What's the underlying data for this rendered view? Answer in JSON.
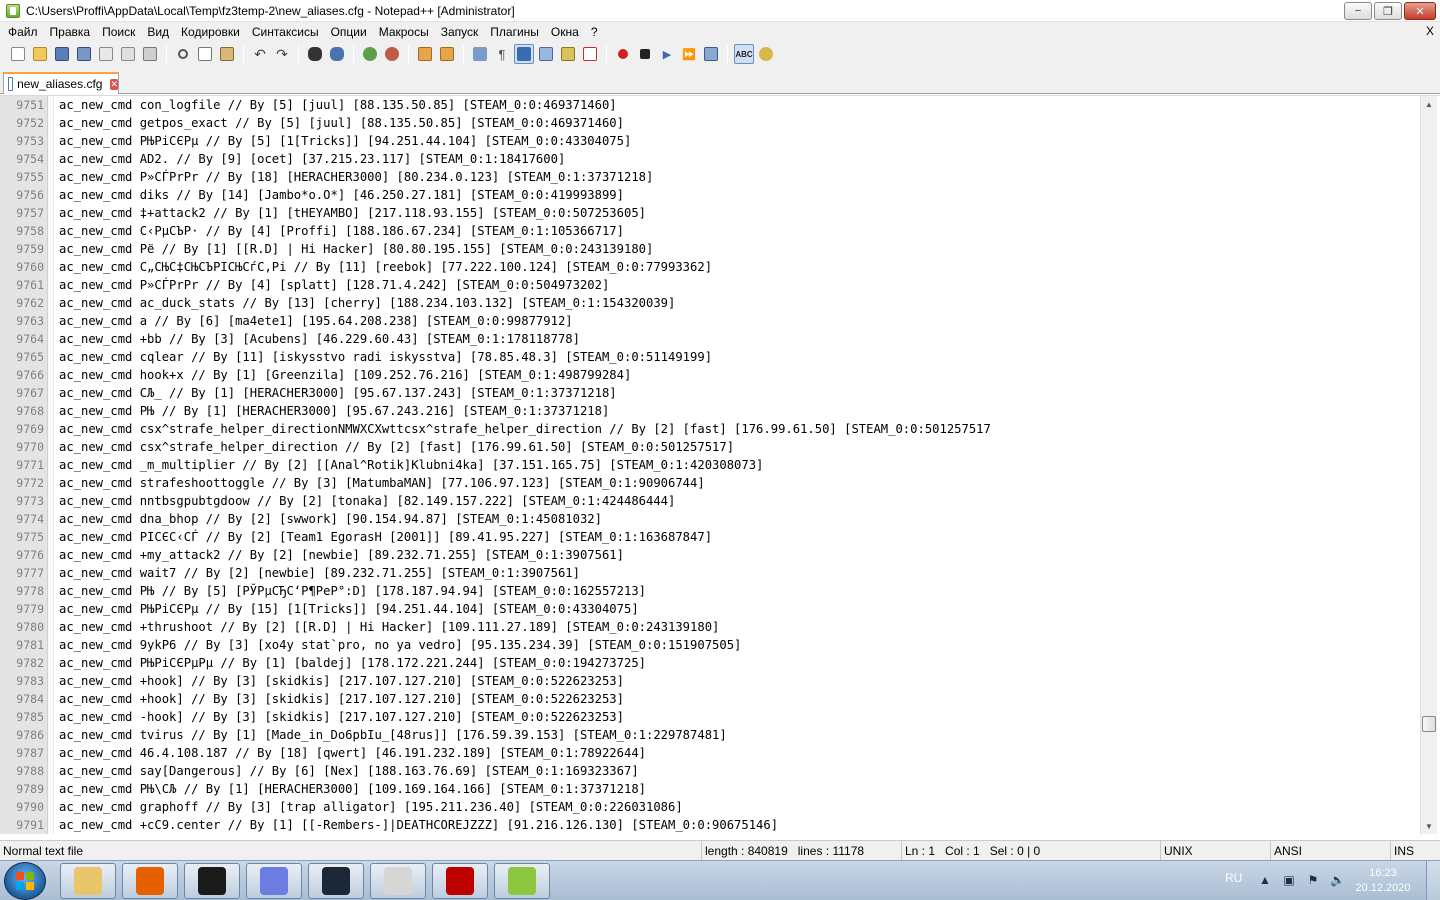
{
  "window": {
    "title": "C:\\Users\\Proffi\\AppData\\Local\\Temp\\fz3temp-2\\new_aliases.cfg - Notepad++ [Administrator]",
    "minimize": "−",
    "maximize": "❐",
    "close": "✕"
  },
  "menu": {
    "items": [
      "Файл",
      "Правка",
      "Поиск",
      "Вид",
      "Кодировки",
      "Синтаксисы",
      "Опции",
      "Макросы",
      "Запуск",
      "Плагины",
      "Окна",
      "?"
    ],
    "close_label": "X"
  },
  "tab": {
    "label": "new_aliases.cfg",
    "close": "✕"
  },
  "editor": {
    "lines": [
      {
        "n": "9751",
        "t": "ac_new_cmd con_logfile // By [5] [juul] [88.135.50.85] [STEAM_0:0:469371460]"
      },
      {
        "n": "9752",
        "t": "ac_new_cmd getpos_exact // By [5] [juul] [88.135.50.85] [STEAM_0:0:469371460]"
      },
      {
        "n": "9753",
        "t": "ac_new_cmd PЊPiCЄPµ // By [5] [1[Tricks]] [94.251.44.104] [STEAM_0:0:43304075]"
      },
      {
        "n": "9754",
        "t": "ac_new_cmd AD2. // By [9] [ocet] [37.215.23.117] [STEAM_0:1:18417600]"
      },
      {
        "n": "9755",
        "t": "ac_new_cmd P»CЃPrPr // By [18] [HERACHER3000] [80.234.0.123] [STEAM_0:1:37371218]"
      },
      {
        "n": "9756",
        "t": "ac_new_cmd diks // By [14] [Jambo*o.O*] [46.250.27.181] [STEAM_0:0:419993899]"
      },
      {
        "n": "9757",
        "t": "ac_new_cmd ‡+attack2 // By [1] [tHEYAMBO] [217.118.93.155] [STEAM_0:0:507253605]"
      },
      {
        "n": "9758",
        "t": "ac_new_cmd C‹PµCЪP· // By [4] [Proffi] [188.186.67.234] [STEAM_0:1:105366717]"
      },
      {
        "n": "9759",
        "t": "ac_new_cmd Pё // By [1] [[R.D] | Hi Hacker] [80.80.195.155] [STEAM_0:0:243139180]"
      },
      {
        "n": "9760",
        "t": "ac_new_cmd C„CЊC‡CЊCЪPICЊCѓC‚Pi // By [11] [reebok] [77.222.100.124] [STEAM_0:0:77993362]"
      },
      {
        "n": "9761",
        "t": "ac_new_cmd P»CЃPrPr // By [4] [splatt] [128.71.4.242] [STEAM_0:0:504973202]"
      },
      {
        "n": "9762",
        "t": "ac_new_cmd ac_duck_stats // By [13] [cherry] [188.234.103.132] [STEAM_0:1:154320039]"
      },
      {
        "n": "9763",
        "t": "ac_new_cmd a // By [6] [ma4ete1] [195.64.208.238] [STEAM_0:0:99877912]"
      },
      {
        "n": "9764",
        "t": "ac_new_cmd +bb // By [3] [Acubens] [46.229.60.43] [STEAM_0:1:178118778]"
      },
      {
        "n": "9765",
        "t": "ac_new_cmd cqlear // By [11] [iskysstvo radi iskysstva] [78.85.48.3] [STEAM_0:0:51149199]"
      },
      {
        "n": "9766",
        "t": "ac_new_cmd hook+x // By [1] [Greenzila] [109.252.76.216] [STEAM_0:1:498799284]"
      },
      {
        "n": "9767",
        "t": "ac_new_cmd CЉ_ // By [1] [HERACHER3000] [95.67.137.243] [STEAM_0:1:37371218]"
      },
      {
        "n": "9768",
        "t": "ac_new_cmd PЊ // By [1] [HERACHER3000] [95.67.243.216] [STEAM_0:1:37371218]"
      },
      {
        "n": "9769",
        "t": "ac_new_cmd csx^strafe_helper_directionNMWXCXwttcsx^strafe_helper_direction // By [2] [fast] [176.99.61.50] [STEAM_0:0:501257517"
      },
      {
        "n": "9770",
        "t": "ac_new_cmd csx^strafe_helper_direction // By [2] [fast] [176.99.61.50] [STEAM_0:0:501257517]"
      },
      {
        "n": "9771",
        "t": "ac_new_cmd _m_multiplier // By [2] [[Anal^Rotik]Klubni4ka] [37.151.165.75] [STEAM_0:1:420308073]"
      },
      {
        "n": "9772",
        "t": "ac_new_cmd strafeshoottoggle // By [3] [MatumbaMAN] [77.106.97.123] [STEAM_0:1:90906744]"
      },
      {
        "n": "9773",
        "t": "ac_new_cmd nntbsgpubtgdoow // By [2] [tonaka] [82.149.157.222] [STEAM_0:1:424486444]"
      },
      {
        "n": "9774",
        "t": "ac_new_cmd dna_bhop // By [2] [swwork] [90.154.94.87] [STEAM_0:1:45081032]"
      },
      {
        "n": "9775",
        "t": "ac_new_cmd PICЄC‹CЃ // By [2] [Team1 EgorasH [2001]] [89.41.95.227] [STEAM_0:1:163687847]"
      },
      {
        "n": "9776",
        "t": "ac_new_cmd +my_attack2 // By [2] [newbie] [89.232.71.255] [STEAM_0:1:3907561]"
      },
      {
        "n": "9777",
        "t": "ac_new_cmd wait7 // By [2] [newbie] [89.232.71.255] [STEAM_0:1:3907561]"
      },
      {
        "n": "9778",
        "t": "ac_new_cmd PЊ // By [5] [PЎPµCЂC‘P¶PeP°:D] [178.187.94.94] [STEAM_0:0:162557213]"
      },
      {
        "n": "9779",
        "t": "ac_new_cmd PЊPiCЄPµ // By [15] [1[Tricks]] [94.251.44.104] [STEAM_0:0:43304075]"
      },
      {
        "n": "9780",
        "t": "ac_new_cmd +thrushoot // By [2] [[R.D] | Hi Hacker] [109.111.27.189] [STEAM_0:0:243139180]"
      },
      {
        "n": "9781",
        "t": "ac_new_cmd 9ykP6 // By [3] [xo4y stat`pro, no ya vedro] [95.135.234.39] [STEAM_0:0:151907505]"
      },
      {
        "n": "9782",
        "t": "ac_new_cmd PЊPiCЄPµPµ // By [1] [baldej] [178.172.221.244] [STEAM_0:0:194273725]"
      },
      {
        "n": "9783",
        "t": "ac_new_cmd +hook] // By [3] [skidkis] [217.107.127.210] [STEAM_0:0:522623253]"
      },
      {
        "n": "9784",
        "t": "ac_new_cmd +hook] // By [3] [skidkis] [217.107.127.210] [STEAM_0:0:522623253]"
      },
      {
        "n": "9785",
        "t": "ac_new_cmd -hook] // By [3] [skidkis] [217.107.127.210] [STEAM_0:0:522623253]"
      },
      {
        "n": "9786",
        "t": "ac_new_cmd tvirus // By [1] [Made_in_Do6pbIu_[48rus]] [176.59.39.153] [STEAM_0:1:229787481]"
      },
      {
        "n": "9787",
        "t": "ac_new_cmd 46.4.108.187 // By [18] [qwert] [46.191.232.189] [STEAM_0:1:78922644]"
      },
      {
        "n": "9788",
        "t": "ac_new_cmd say[Dangerous] // By [6] [Nex] [188.163.76.69] [STEAM_0:1:169323367]"
      },
      {
        "n": "9789",
        "t": "ac_new_cmd PЊ\\CЉ // By [1] [HERACHER3000] [109.169.164.166] [STEAM_0:1:37371218]"
      },
      {
        "n": "9790",
        "t": "ac_new_cmd graphoff // By [3] [trap alligator] [195.211.236.40] [STEAM_0:0:226031086]"
      },
      {
        "n": "9791",
        "t": "ac_new_cmd +cC9.center // By [1] [[-Rembers-]|DEATHCOREJZZZ] [91.216.126.130] [STEAM_0:0:90675146]"
      }
    ]
  },
  "status": {
    "file_type": "Normal text file",
    "length": "length : 840819",
    "lines": "lines : 11178",
    "ln": "Ln : 1",
    "col": "Col : 1",
    "sel": "Sel : 0 | 0",
    "eol": "UNIX",
    "encoding": "ANSI",
    "mode": "INS"
  },
  "taskbar": {
    "lang": "RU",
    "time": "16:23",
    "date": "20.12.2020",
    "apps": [
      {
        "name": "explorer-icon",
        "color": "#e8c56a"
      },
      {
        "name": "firefox-icon",
        "color": "#e66000"
      },
      {
        "name": "ghost-app-icon",
        "color": "#1a1a1a"
      },
      {
        "name": "discord-icon",
        "color": "#6b7de0"
      },
      {
        "name": "steam-icon",
        "color": "#1b2838"
      },
      {
        "name": "counter-strike-icon",
        "color": "#d6d6d6"
      },
      {
        "name": "filezilla-icon",
        "color": "#bf0000"
      },
      {
        "name": "notepadpp-icon",
        "color": "#8dc63f"
      }
    ]
  }
}
